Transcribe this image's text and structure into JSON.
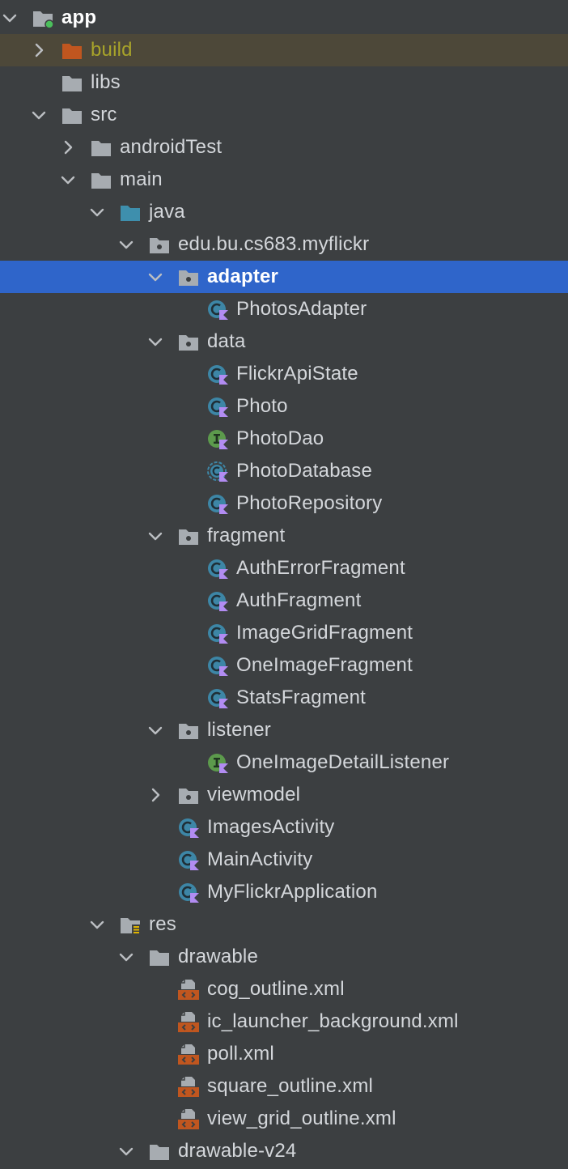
{
  "colors": {
    "background": "#3c3f41",
    "selected_row": "#2f65ca",
    "excluded_row": "#4d4839",
    "excluded_text": "#a8a32a",
    "text": "#d4d7db",
    "folder_gray": "#a7acb1",
    "source_folder": "#3e8fad",
    "excluded_folder": "#c0561f",
    "kotlin_class": "#3d86a6",
    "interface": "#5c9a4c",
    "kotlin_mark": "#b28cf2",
    "xml_file": "#c0561f"
  },
  "tree": [
    {
      "label": "app",
      "depth": 0,
      "expanded": true,
      "icon": "module-folder-icon",
      "bold": true
    },
    {
      "label": "build",
      "depth": 1,
      "expanded": false,
      "icon": "excluded-folder-icon",
      "state": "excluded"
    },
    {
      "label": "libs",
      "depth": 1,
      "icon": "folder-icon"
    },
    {
      "label": "src",
      "depth": 1,
      "expanded": true,
      "icon": "folder-icon"
    },
    {
      "label": "androidTest",
      "depth": 2,
      "expanded": false,
      "icon": "folder-icon"
    },
    {
      "label": "main",
      "depth": 2,
      "expanded": true,
      "icon": "folder-icon"
    },
    {
      "label": "java",
      "depth": 3,
      "expanded": true,
      "icon": "source-folder-icon"
    },
    {
      "label": "edu.bu.cs683.myflickr",
      "depth": 4,
      "expanded": true,
      "icon": "package-icon"
    },
    {
      "label": "adapter",
      "depth": 5,
      "expanded": true,
      "icon": "package-icon",
      "state": "selected"
    },
    {
      "label": "PhotosAdapter",
      "depth": 6,
      "icon": "kotlin-class-icon"
    },
    {
      "label": "data",
      "depth": 5,
      "expanded": true,
      "icon": "package-icon"
    },
    {
      "label": "FlickrApiState",
      "depth": 6,
      "icon": "kotlin-class-icon"
    },
    {
      "label": "Photo",
      "depth": 6,
      "icon": "kotlin-class-icon"
    },
    {
      "label": "PhotoDao",
      "depth": 6,
      "icon": "kotlin-interface-icon"
    },
    {
      "label": "PhotoDatabase",
      "depth": 6,
      "icon": "kotlin-abstract-class-icon"
    },
    {
      "label": "PhotoRepository",
      "depth": 6,
      "icon": "kotlin-class-icon"
    },
    {
      "label": "fragment",
      "depth": 5,
      "expanded": true,
      "icon": "package-icon"
    },
    {
      "label": "AuthErrorFragment",
      "depth": 6,
      "icon": "kotlin-class-icon"
    },
    {
      "label": "AuthFragment",
      "depth": 6,
      "icon": "kotlin-class-icon"
    },
    {
      "label": "ImageGridFragment",
      "depth": 6,
      "icon": "kotlin-class-icon"
    },
    {
      "label": "OneImageFragment",
      "depth": 6,
      "icon": "kotlin-class-icon"
    },
    {
      "label": "StatsFragment",
      "depth": 6,
      "icon": "kotlin-class-icon"
    },
    {
      "label": "listener",
      "depth": 5,
      "expanded": true,
      "icon": "package-icon"
    },
    {
      "label": "OneImageDetailListener",
      "depth": 6,
      "icon": "kotlin-interface-icon"
    },
    {
      "label": "viewmodel",
      "depth": 5,
      "expanded": false,
      "icon": "package-icon"
    },
    {
      "label": "ImagesActivity",
      "depth": 5,
      "icon": "kotlin-class-icon"
    },
    {
      "label": "MainActivity",
      "depth": 5,
      "icon": "kotlin-class-icon"
    },
    {
      "label": "MyFlickrApplication",
      "depth": 5,
      "icon": "kotlin-class-icon"
    },
    {
      "label": "res",
      "depth": 3,
      "expanded": true,
      "icon": "resource-folder-icon"
    },
    {
      "label": "drawable",
      "depth": 4,
      "expanded": true,
      "icon": "folder-icon"
    },
    {
      "label": "cog_outline.xml",
      "depth": 5,
      "icon": "xml-file-icon"
    },
    {
      "label": "ic_launcher_background.xml",
      "depth": 5,
      "icon": "xml-file-icon"
    },
    {
      "label": "poll.xml",
      "depth": 5,
      "icon": "xml-file-icon"
    },
    {
      "label": "square_outline.xml",
      "depth": 5,
      "icon": "xml-file-icon"
    },
    {
      "label": "view_grid_outline.xml",
      "depth": 5,
      "icon": "xml-file-icon"
    },
    {
      "label": "drawable-v24",
      "depth": 4,
      "expanded": true,
      "icon": "folder-icon"
    }
  ]
}
